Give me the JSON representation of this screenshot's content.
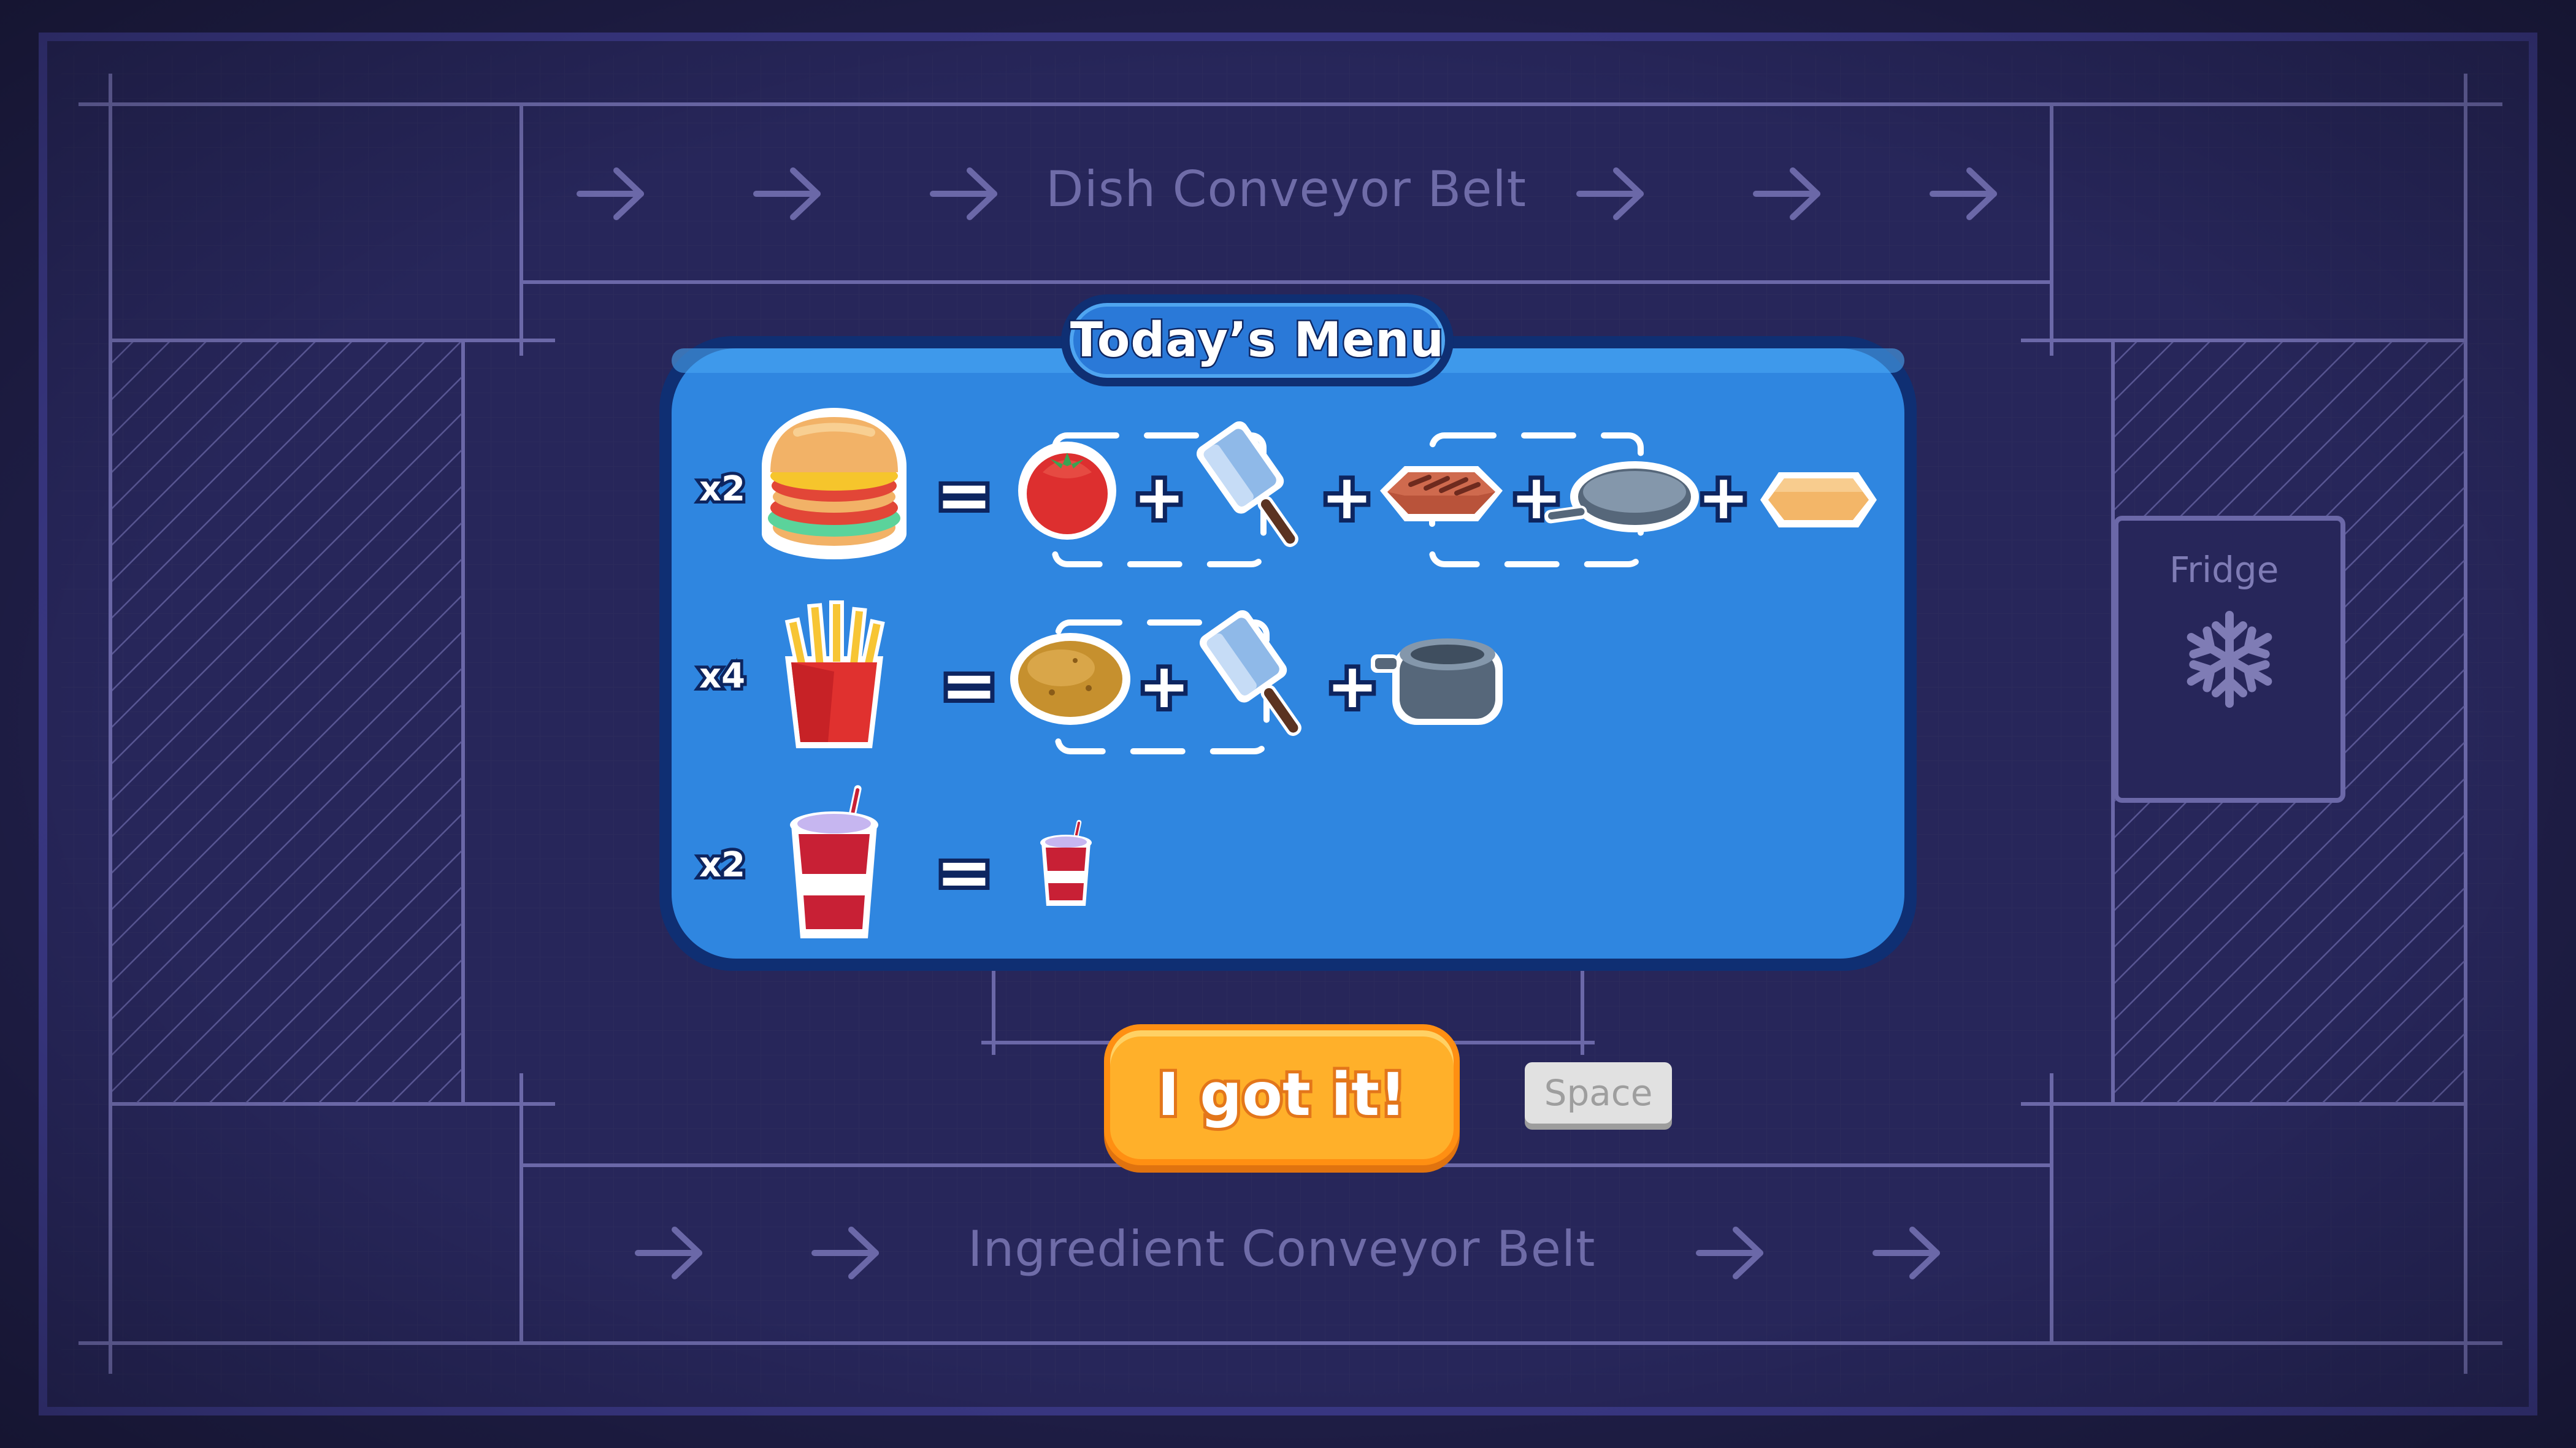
{
  "layout": {
    "top_belt_label": "Dish Conveyor Belt",
    "bottom_belt_label": "Ingredient Conveyor Belt",
    "fridge_label": "Fridge",
    "fridge_icon": "snowflake-icon"
  },
  "menu": {
    "title": "Today’s Menu",
    "rows": [
      {
        "dish": "burger",
        "quantity": "x2",
        "ingredients": [
          "tomato + cleaver",
          "meat patty + pan",
          "bun"
        ]
      },
      {
        "dish": "fries",
        "quantity": "x4",
        "ingredients": [
          "potato + cleaver",
          "pot"
        ]
      },
      {
        "dish": "soda",
        "quantity": "x2",
        "ingredients": [
          "soda cup"
        ]
      }
    ]
  },
  "actions": {
    "confirm_label": "I got it!",
    "confirm_key": "Space"
  },
  "colors": {
    "background": "#1f1e47",
    "menu_panel": "#2f86e0",
    "menu_border": "#0f2f73",
    "confirm_button": "#ffb02a"
  }
}
